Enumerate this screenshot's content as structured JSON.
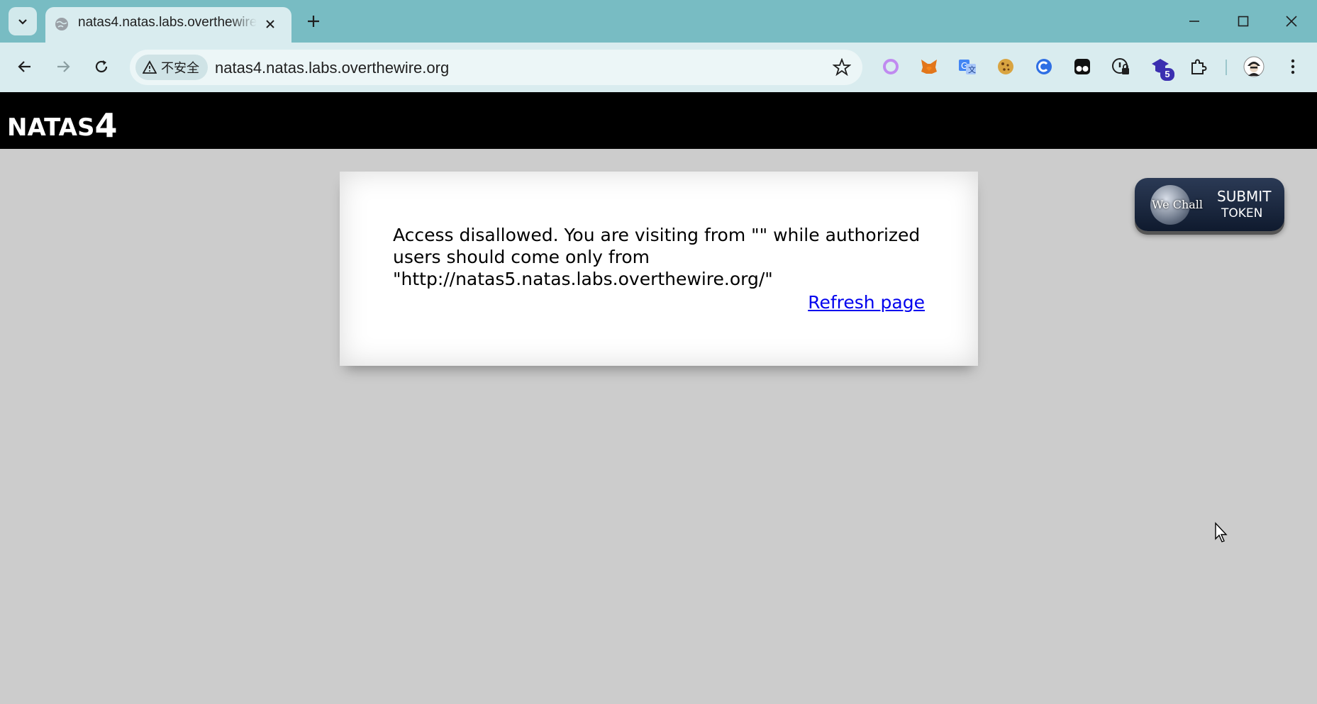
{
  "browser": {
    "tab_title": "natas4.natas.labs.overthewire.org",
    "security_label": "不安全",
    "url": "natas4.natas.labs.overthewire.org",
    "extension_badge": "5"
  },
  "page": {
    "logo_text": "NATAS",
    "logo_number": "4",
    "message": "Access disallowed. You are visiting from \"\" while authorized users should come only from \"http://natas5.natas.labs.overthewire.org/\"",
    "refresh_label": "Refresh page",
    "wechall_label": "We Chall",
    "submit_label_1": "SUBMIT",
    "submit_label_2": "TOKEN"
  },
  "colors": {
    "titlebar": "#78bcc3",
    "toolbar": "#d9ecef",
    "page_bg": "#cccccc",
    "header_bg": "#000000",
    "link": "#0000ee"
  }
}
